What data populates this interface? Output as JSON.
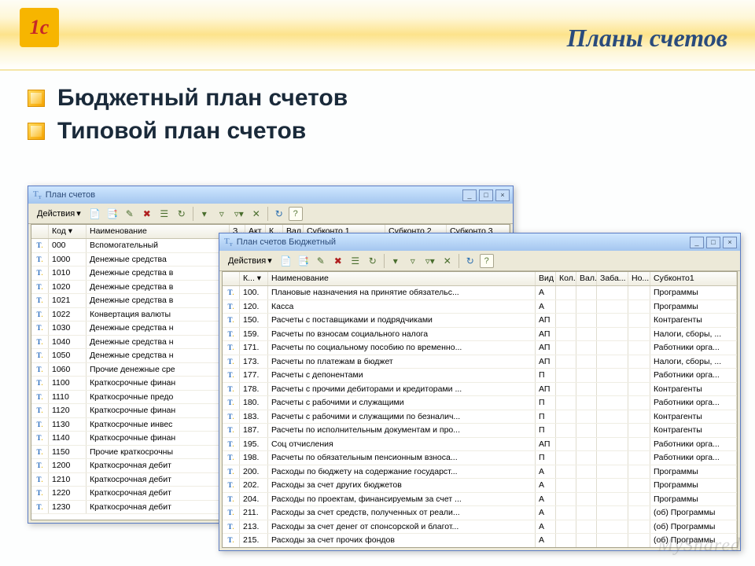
{
  "slide": {
    "title": "Планы счетов",
    "bullet1": "Бюджетный план счетов",
    "bullet2": "Типовой план счетов"
  },
  "watermark": "MyShared",
  "win1": {
    "title": "План счетов",
    "actions": "Действия",
    "cols": {
      "code": "Код",
      "name": "Наименование",
      "z": "З...",
      "akt": "Акт.",
      "k": "К...",
      "val": "Вал.",
      "s1": "Субконто 1",
      "s2": "Субконто 2",
      "s3": "Субконто 3"
    },
    "rows": [
      {
        "code": "000",
        "name": "Вспомогательный"
      },
      {
        "code": "1000",
        "name": "Денежные средства"
      },
      {
        "code": "1010",
        "name": "Денежные средства в"
      },
      {
        "code": "1020",
        "name": "Денежные средства в"
      },
      {
        "code": "1021",
        "name": "Денежные средства в"
      },
      {
        "code": "1022",
        "name": "Конвертация валюты"
      },
      {
        "code": "1030",
        "name": "Денежные средства н"
      },
      {
        "code": "1040",
        "name": "Денежные средства н"
      },
      {
        "code": "1050",
        "name": "Денежные средства н"
      },
      {
        "code": "1060",
        "name": "Прочие денежные сре"
      },
      {
        "code": "1100",
        "name": "Краткосрочные финан"
      },
      {
        "code": "1110",
        "name": "Краткосрочные предо"
      },
      {
        "code": "1120",
        "name": "Краткосрочные финан"
      },
      {
        "code": "1130",
        "name": "Краткосрочные инвес"
      },
      {
        "code": "1140",
        "name": "Краткосрочные финан"
      },
      {
        "code": "1150",
        "name": "Прочие краткосрочны"
      },
      {
        "code": "1200",
        "name": "Краткосрочная дебит"
      },
      {
        "code": "1210",
        "name": "Краткосрочная дебит"
      },
      {
        "code": "1220",
        "name": "Краткосрочная дебит"
      },
      {
        "code": "1230",
        "name": "Краткосрочная дебит"
      }
    ]
  },
  "win2": {
    "title": "План счетов Бюджетный",
    "actions": "Действия",
    "cols": {
      "code": "К...",
      "name": "Наименование",
      "vid": "Вид",
      "kol": "Кол.",
      "val": "Вал.",
      "zab": "Заба...",
      "no": "Но...",
      "s1": "Субконто1"
    },
    "rows": [
      {
        "code": "100.",
        "name": "Плановые назначения на принятие обязательс...",
        "vid": "А",
        "s1": "Программы"
      },
      {
        "code": "120.",
        "name": "Касса",
        "vid": "А",
        "s1": "Программы"
      },
      {
        "code": "150.",
        "name": "Расчеты с поставщиками и подрядчиками",
        "vid": "АП",
        "s1": "Контрагенты"
      },
      {
        "code": "159.",
        "name": "Расчеты по взносам социального налога",
        "vid": "АП",
        "s1": "Налоги, сборы, ..."
      },
      {
        "code": "171.",
        "name": "Расчеты по социальному пособию по временно...",
        "vid": "АП",
        "s1": "Работники орга..."
      },
      {
        "code": "173.",
        "name": "Расчеты по платежам в бюджет",
        "vid": "АП",
        "s1": "Налоги, сборы, ..."
      },
      {
        "code": "177.",
        "name": "Расчеты с депонентами",
        "vid": "П",
        "s1": "Работники орга..."
      },
      {
        "code": "178.",
        "name": "Расчеты с прочими дебиторами и кредиторами ...",
        "vid": "АП",
        "s1": "Контрагенты"
      },
      {
        "code": "180.",
        "name": "Расчеты с рабочими и служащими",
        "vid": "П",
        "s1": "Работники орга..."
      },
      {
        "code": "183.",
        "name": "Расчеты с рабочими и служащими по безналич...",
        "vid": "П",
        "s1": "Контрагенты"
      },
      {
        "code": "187.",
        "name": "Расчеты по исполнительным документам и про...",
        "vid": "П",
        "s1": "Контрагенты"
      },
      {
        "code": "195.",
        "name": "Соц отчисления",
        "vid": "АП",
        "s1": "Работники орга..."
      },
      {
        "code": "198.",
        "name": "Расчеты по обязательным пенсионным взноса...",
        "vid": "П",
        "s1": "Работники орга..."
      },
      {
        "code": "200.",
        "name": "Расходы по бюджету на содержание государст...",
        "vid": "А",
        "s1": "Программы"
      },
      {
        "code": "202.",
        "name": "Расходы за счет других бюджетов",
        "vid": "А",
        "s1": "Программы"
      },
      {
        "code": "204.",
        "name": "Расходы по проектам, финансируемым за счет ...",
        "vid": "А",
        "s1": "Программы"
      },
      {
        "code": "211.",
        "name": "Расходы за счет средств, полученных от реали...",
        "vid": "А",
        "s1": "(об) Программы"
      },
      {
        "code": "213.",
        "name": "Расходы за счет денег от спонсорской и благот...",
        "vid": "А",
        "s1": "(об) Программы"
      },
      {
        "code": "215.",
        "name": "Расходы за счет прочих фондов",
        "vid": "А",
        "s1": "(об) Программы"
      }
    ]
  }
}
